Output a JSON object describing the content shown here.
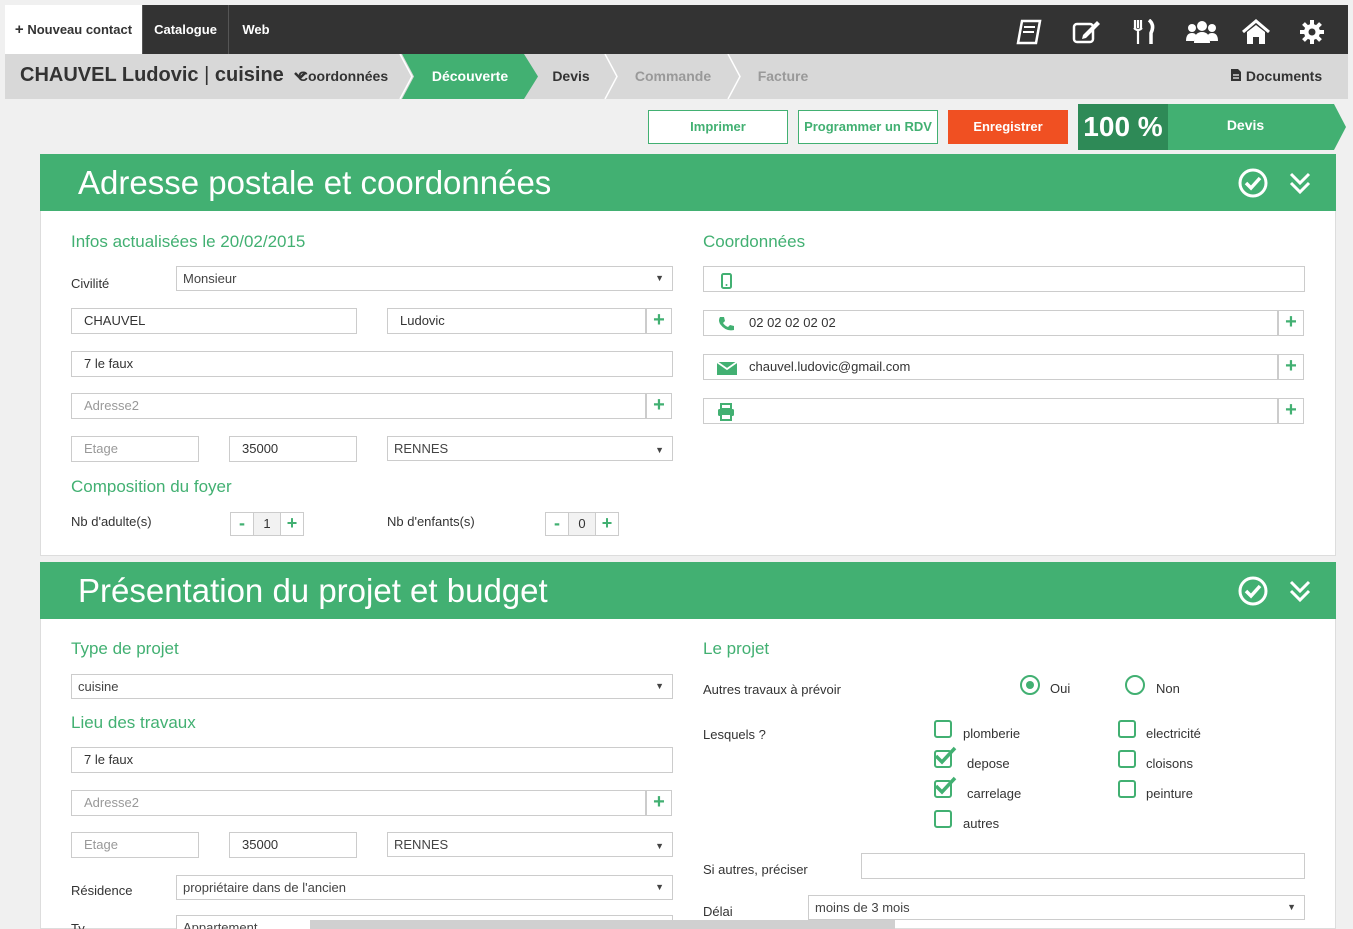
{
  "topbar": {
    "tabs": [
      {
        "label": "Nouveau contact",
        "icon": "plus-icon"
      },
      {
        "label": "Catalogue"
      },
      {
        "label": "Web"
      }
    ],
    "icons": [
      "notebook-icon",
      "edit-icon",
      "cutlery-icon",
      "users-icon",
      "home-icon",
      "gear-icon"
    ]
  },
  "subbar": {
    "contact_name": "CHAUVEL Ludovic",
    "separator": "|",
    "project": "cuisine",
    "steps": [
      {
        "label": "Coordonnées",
        "state": "done"
      },
      {
        "label": "Découverte",
        "state": "current"
      },
      {
        "label": "Devis",
        "state": "done"
      },
      {
        "label": "Commande",
        "state": "disabled"
      },
      {
        "label": "Facture",
        "state": "disabled"
      }
    ],
    "documents_label": "Documents"
  },
  "actions": {
    "print": "Imprimer",
    "schedule": "Programmer un RDV",
    "save": "Enregistrer",
    "progress": "100 %",
    "next_step": "Devis"
  },
  "colors": {
    "accent": "#42b072",
    "dark": "#333333",
    "save": "#f05022"
  },
  "section1": {
    "title": "Adresse postale et coordonnées",
    "infos_title": "Infos actualisées le 20/02/2015",
    "civilite_label": "Civilité",
    "civilite_value": "Monsieur",
    "nom": "CHAUVEL",
    "prenom": "Ludovic",
    "adresse1": "7 le faux",
    "adresse2_placeholder": "Adresse2",
    "etage_placeholder": "Etage",
    "cp": "35000",
    "ville": "RENNES",
    "composition_title": "Composition du foyer",
    "adultes_label": "Nb d'adulte(s)",
    "adultes_value": "1",
    "enfants_label": "Nb d'enfants(s)",
    "enfants_value": "0",
    "minus": "-",
    "plus": "+",
    "coord_title": "Coordonnées",
    "mobile": "",
    "phone": "02 02 02 02 02",
    "email": "chauvel.ludovic@gmail.com",
    "fax": ""
  },
  "section2": {
    "title": "Présentation du projet et budget",
    "type_title": "Type de projet",
    "type_value": "cuisine",
    "lieu_title": "Lieu des travaux",
    "adresse1": "7 le faux",
    "adresse2_placeholder": "Adresse2",
    "etage_placeholder": "Etage",
    "cp": "35000",
    "ville": "RENNES",
    "residence_label": "Résidence",
    "residence_value": "propriétaire dans de l'ancien",
    "type_logement_label": "Ty",
    "type_logement_value": "Appartement",
    "projet_title": "Le projet",
    "autres_travaux_label": "Autres travaux à prévoir",
    "oui": "Oui",
    "non": "Non",
    "autres_travaux_selected": "Oui",
    "lesquels_label": "Lesquels ?",
    "travaux": [
      {
        "label": "plomberie",
        "checked": false
      },
      {
        "label": "depose",
        "checked": true
      },
      {
        "label": "carrelage",
        "checked": true
      },
      {
        "label": "autres",
        "checked": false
      },
      {
        "label": "electricité",
        "checked": false
      },
      {
        "label": "cloisons",
        "checked": false
      },
      {
        "label": "peinture",
        "checked": false
      }
    ],
    "preciser_label": "Si autres, préciser",
    "preciser_value": "",
    "delai_label": "Délai",
    "delai_value": "moins de 3 mois"
  }
}
